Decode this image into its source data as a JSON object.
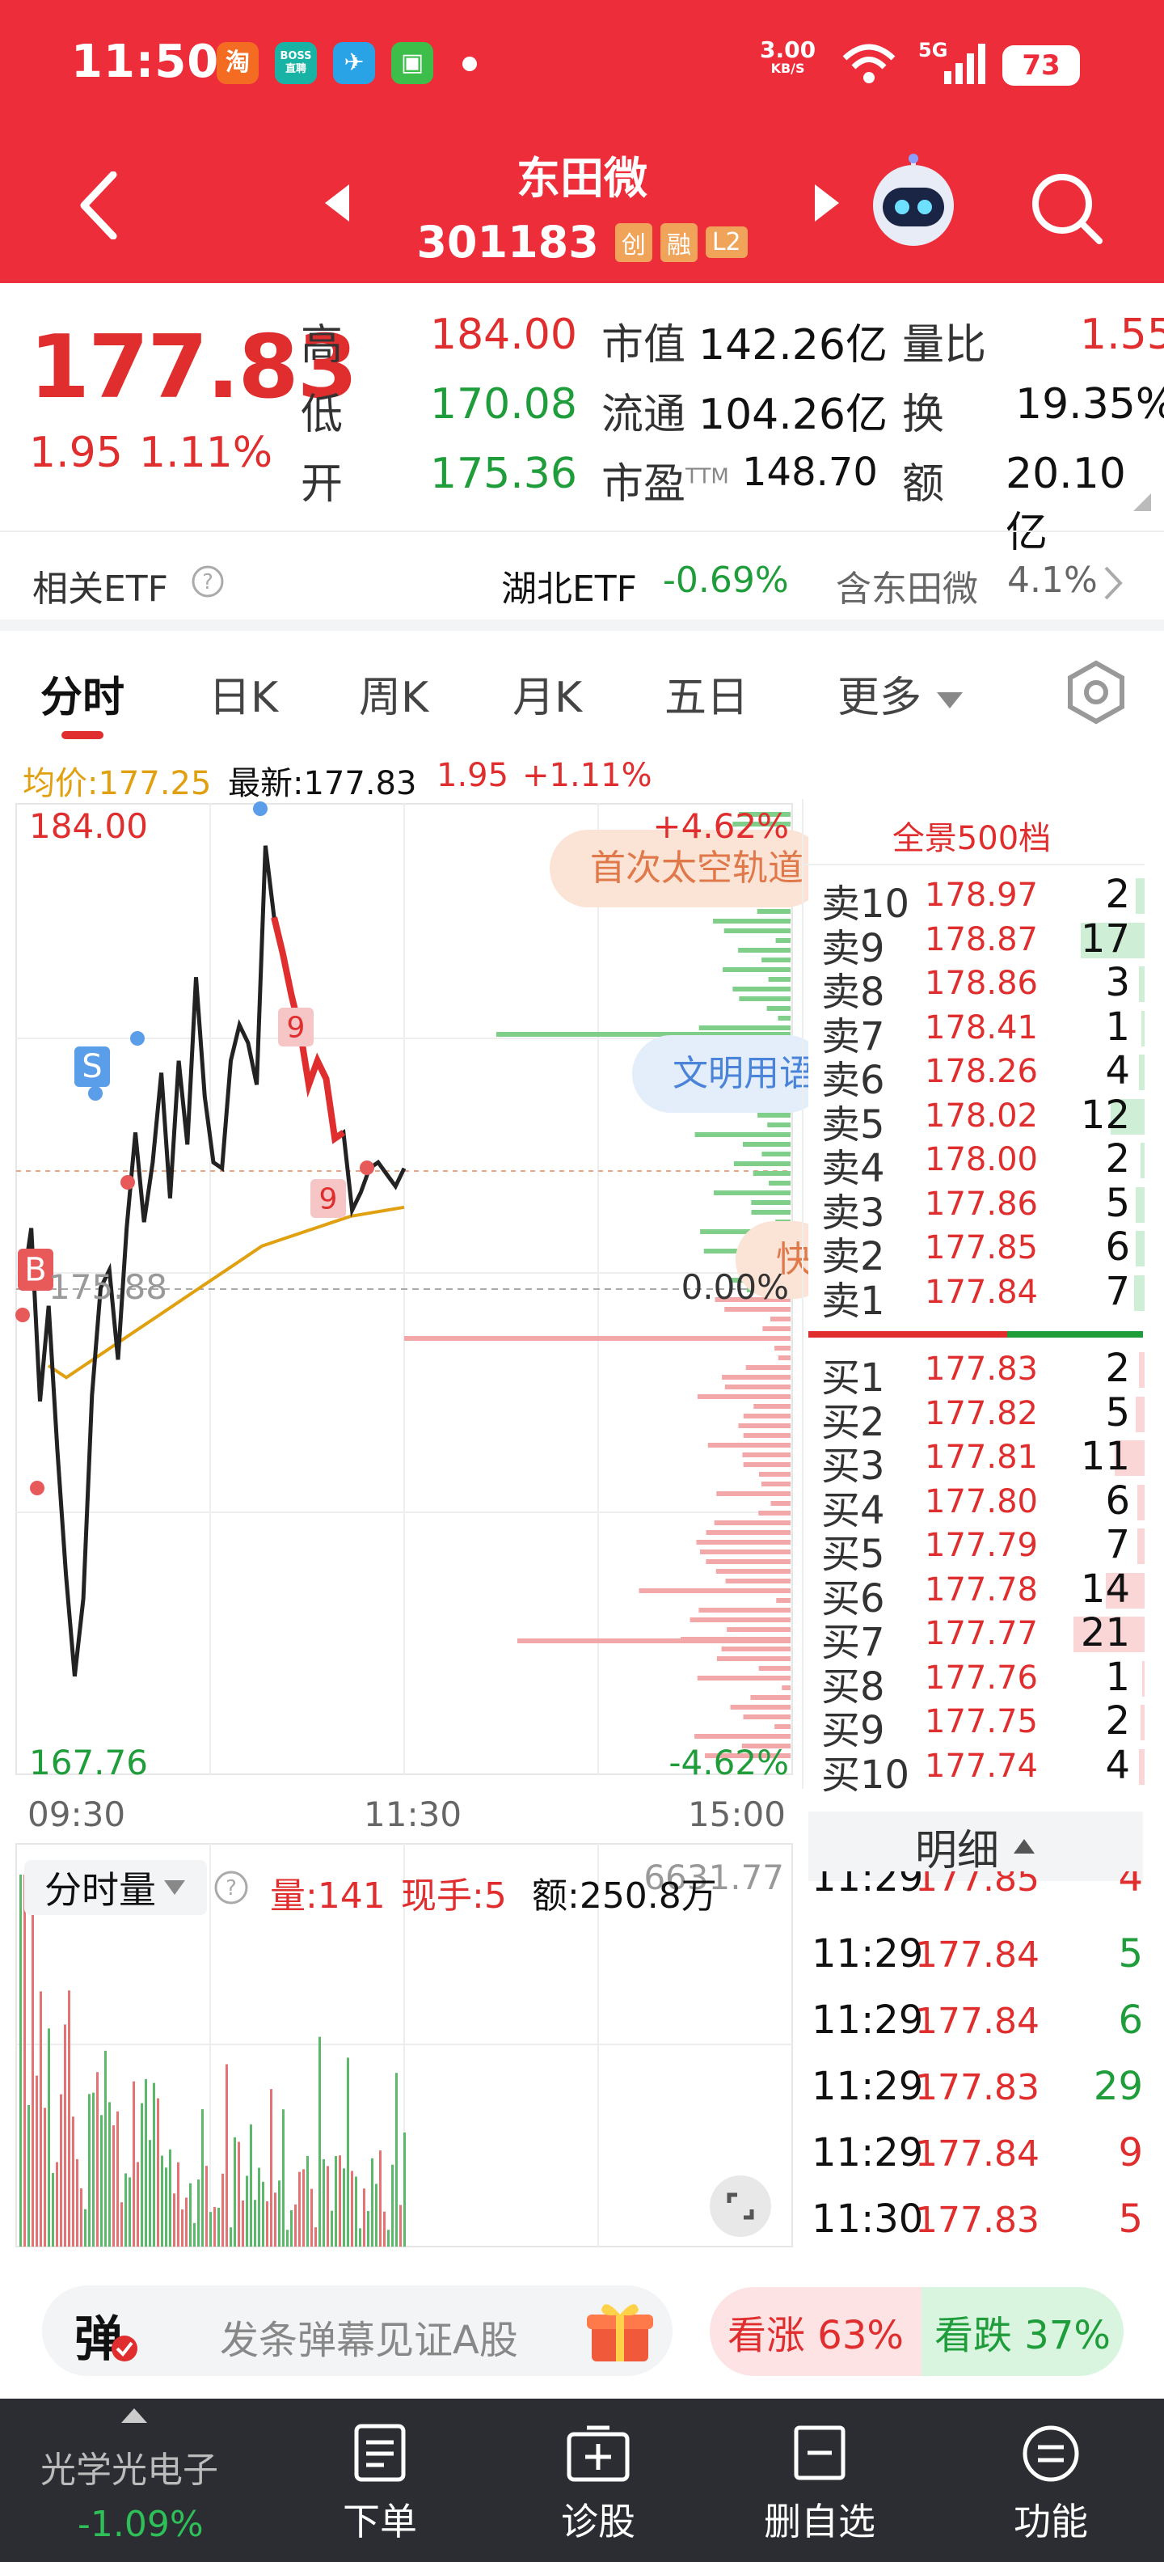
{
  "status_bar": {
    "time": "11:50",
    "apps": [
      "淘",
      "BOSS直聘",
      "✈",
      "▣"
    ],
    "net_speed": "3.00",
    "net_unit": "KB/S",
    "network": "5G",
    "battery": "73"
  },
  "header": {
    "stock_name": "东田微",
    "stock_code": "301183",
    "tags": [
      "创",
      "融",
      "L2"
    ]
  },
  "quote": {
    "price": "177.83",
    "change": "1.95",
    "change_pct": "1.11%",
    "fields": [
      {
        "label": "高",
        "value": "184.00"
      },
      {
        "label": "低",
        "value": "170.08"
      },
      {
        "label": "开",
        "value": "175.36"
      },
      {
        "label": "市值",
        "value": "142.26亿"
      },
      {
        "label": "流通",
        "value": "104.26亿"
      },
      {
        "label": "市盈",
        "sup": "TTM",
        "value": "148.70"
      },
      {
        "label": "量比",
        "value": "1.55"
      },
      {
        "label": "换",
        "value": "19.35%"
      },
      {
        "label": "额",
        "value": "20.10亿"
      }
    ]
  },
  "etf": {
    "label": "相关ETF",
    "name": "湖北ETF",
    "change": "-0.69%",
    "holding_label": "含东田微",
    "holding_pct": "4.1%"
  },
  "tabs": [
    "分时",
    "日K",
    "周K",
    "月K",
    "五日",
    "更多"
  ],
  "info": {
    "avg": "均价:177.25",
    "latest": "最新:177.83",
    "change": "1.95",
    "change_pct": "+1.11%"
  },
  "chart_data": {
    "type": "line",
    "title": "",
    "y_max_label": "184.00",
    "y_min_label": "167.76",
    "y_ref_label": "175.88",
    "pct_max_label": "+4.62%",
    "pct_min_label": "-4.62%",
    "pct_ref_label": "0.00%",
    "x_labels": [
      "09:30",
      "11:30",
      "15:00"
    ],
    "ylim": [
      167.76,
      184.0
    ],
    "series": [],
    "price": [
      175.9,
      176.9,
      174.0,
      175.6,
      173.2,
      171.1,
      169.4,
      170.7,
      174.1,
      175.9,
      176.2,
      174.7,
      176.9,
      178.5,
      177.0,
      178.0,
      179.5,
      177.4,
      179.7,
      178.3,
      181.1,
      179.1,
      178.0,
      177.9,
      179.7,
      180.3,
      180.0,
      179.3,
      183.3,
      182.1,
      181.5,
      180.8,
      180.2,
      179.3,
      179.7,
      179.4,
      178.4,
      178.5,
      177.2,
      177.5,
      177.9,
      178.0,
      177.8,
      177.6,
      177.9
    ],
    "avg_price": [
      174.6,
      174.4,
      174.6,
      174.8,
      175.0,
      175.2,
      175.4,
      175.6,
      175.8,
      176.0,
      176.2,
      176.4,
      176.6,
      176.7,
      176.8,
      176.9,
      177.0,
      177.1,
      177.15,
      177.2,
      177.25
    ],
    "marks": [
      {
        "label": "S"
      },
      {
        "label": "B"
      },
      {
        "label": "9"
      },
      {
        "label": "9"
      }
    ],
    "annotations": [
      "首次太空轨道",
      "文明用语",
      "快"
    ]
  },
  "order_book": {
    "title": "全景500档",
    "asks": [
      {
        "label": "卖10",
        "price": "178.97",
        "vol": 2,
        "bar": 0.1
      },
      {
        "label": "卖9",
        "price": "178.87",
        "vol": 17,
        "bar": 0.72
      },
      {
        "label": "卖8",
        "price": "178.86",
        "vol": 3,
        "bar": 0.06
      },
      {
        "label": "卖7",
        "price": "178.41",
        "vol": 1,
        "bar": 0.04
      },
      {
        "label": "卖6",
        "price": "178.26",
        "vol": 4,
        "bar": 0.06
      },
      {
        "label": "卖5",
        "price": "178.02",
        "vol": 12,
        "bar": 0.38
      },
      {
        "label": "卖4",
        "price": "178.00",
        "vol": 2,
        "bar": 0.05
      },
      {
        "label": "卖3",
        "price": "177.86",
        "vol": 5,
        "bar": 0.1
      },
      {
        "label": "卖2",
        "price": "177.85",
        "vol": 6,
        "bar": 0.1
      },
      {
        "label": "卖1",
        "price": "177.84",
        "vol": 7,
        "bar": 0.12
      }
    ],
    "bids": [
      {
        "label": "买1",
        "price": "177.83",
        "vol": 2,
        "bar": 0.06
      },
      {
        "label": "买2",
        "price": "177.82",
        "vol": 5,
        "bar": 0.1
      },
      {
        "label": "买3",
        "price": "177.81",
        "vol": 11,
        "bar": 0.34
      },
      {
        "label": "买4",
        "price": "177.80",
        "vol": 6,
        "bar": 0.08
      },
      {
        "label": "买5",
        "price": "177.79",
        "vol": 7,
        "bar": 0.08
      },
      {
        "label": "买6",
        "price": "177.78",
        "vol": 14,
        "bar": 0.44
      },
      {
        "label": "买7",
        "price": "177.77",
        "vol": 21,
        "bar": 0.8
      },
      {
        "label": "买8",
        "price": "177.76",
        "vol": 1,
        "bar": 0.03
      },
      {
        "label": "买9",
        "price": "177.75",
        "vol": 2,
        "bar": 0.05
      },
      {
        "label": "买10",
        "price": "177.74",
        "vol": 4,
        "bar": 0.06
      }
    ]
  },
  "detail": {
    "title": "明细",
    "rows": [
      {
        "time": "11:29",
        "price": "177.85",
        "vol": "4",
        "dir": "red"
      },
      {
        "time": "11:29",
        "price": "177.84",
        "vol": "5",
        "dir": "green"
      },
      {
        "time": "11:29",
        "price": "177.84",
        "vol": "6",
        "dir": "green"
      },
      {
        "time": "11:29",
        "price": "177.83",
        "vol": "29",
        "dir": "green"
      },
      {
        "time": "11:29",
        "price": "177.84",
        "vol": "9",
        "dir": "red"
      },
      {
        "time": "11:30",
        "price": "177.83",
        "vol": "5",
        "dir": "red"
      }
    ]
  },
  "volume": {
    "selector": "分时量",
    "qty": "量:141",
    "hand": "现手:5",
    "amount": "额:250.8万",
    "max_label": "6631.77"
  },
  "bottom": {
    "danmu_icon": "弹",
    "danmu_placeholder": "发条弹幕见证A股",
    "vote_up": "看涨 63%",
    "vote_down": "看跌 37%"
  },
  "nav": {
    "sector_name": "光学光电子",
    "sector_change": "-1.09%",
    "items": [
      "下单",
      "诊股",
      "删自选",
      "功能"
    ]
  },
  "colors": {
    "brand": "#ee2d3a",
    "up": "#e02d2d",
    "down": "#1f9d3a",
    "avg_line": "#e0a010"
  }
}
